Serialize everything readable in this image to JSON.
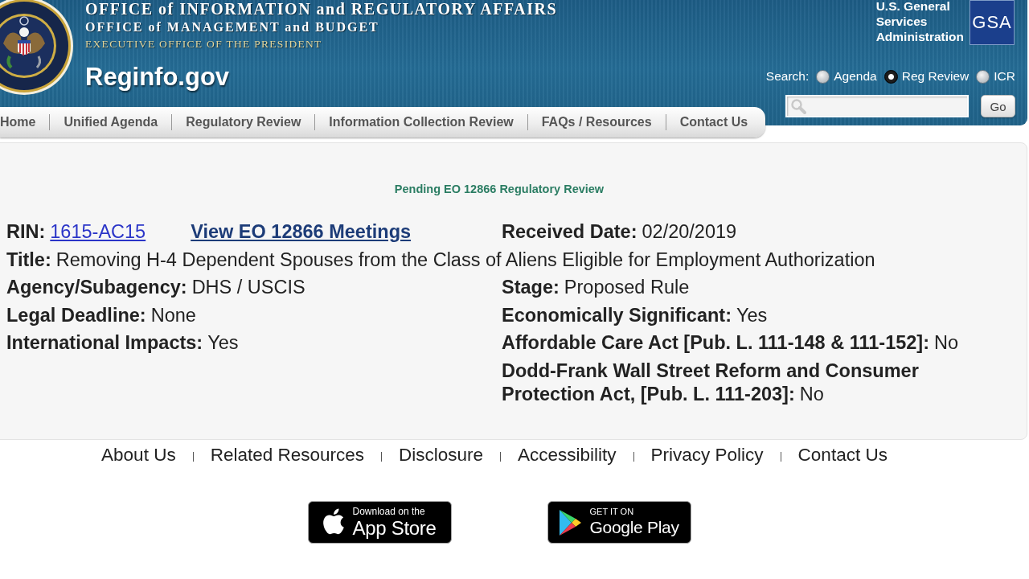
{
  "header": {
    "title_lines": [
      "OFFICE of INFORMATION and REGULATORY AFFAIRS",
      "OFFICE of MANAGEMENT and BUDGET",
      "EXECUTIVE OFFICE OF THE PRESIDENT"
    ],
    "site_name": "Reginfo.gov",
    "agency": {
      "name_lines": [
        "U.S. General",
        "Services",
        "Administration"
      ],
      "logo": "GSA"
    },
    "search": {
      "label": "Search:",
      "options": [
        {
          "label": "Agenda",
          "selected": false
        },
        {
          "label": "Reg Review",
          "selected": true
        },
        {
          "label": "ICR",
          "selected": false
        }
      ],
      "button": "Go"
    }
  },
  "nav": [
    "Home",
    "Unified Agenda",
    "Regulatory Review",
    "Information Collection Review",
    "FAQs / Resources",
    "Contact Us"
  ],
  "review": {
    "heading": "Pending EO 12866 Regulatory Review",
    "rows": [
      {
        "left": {
          "label": "RIN:",
          "link": "1615-AC15"
        },
        "link": "View EO 12866 Meetings",
        "right": {
          "label": "Received Date:",
          "value": "02/20/2019"
        }
      },
      {
        "full": {
          "label": "Title:",
          "value": "Removing H-4 Dependent Spouses from the Class of Aliens Eligible for Employment Authorization"
        }
      },
      {
        "left": {
          "label": "Agency/Subagency:",
          "value": "DHS / USCIS"
        },
        "right": {
          "label": "Stage:",
          "value": "Proposed Rule"
        }
      },
      {
        "left": {
          "label": "Legal Deadline:",
          "value": "None"
        },
        "right": {
          "label": "Economically Significant:",
          "value": "Yes"
        }
      },
      {
        "left": {
          "label": "International Impacts:",
          "value": "Yes"
        },
        "right": {
          "label": "Affordable Care Act [Pub. L. 111-148 & 111-152]:",
          "value": "No"
        }
      },
      {
        "right": {
          "label": "Dodd-Frank Wall Street Reform and Consumer Protection Act, [Pub. L. 111-203]:",
          "value": "No"
        }
      }
    ]
  },
  "footer": {
    "links": [
      "About Us",
      "Related Resources",
      "Disclosure",
      "Accessibility",
      "Privacy Policy",
      "Contact Us"
    ],
    "badges": [
      {
        "kind": "apple",
        "caption": "Download on the",
        "title": "App Store"
      },
      {
        "kind": "google",
        "caption": "GET IT ON",
        "title": "Google Play"
      }
    ]
  }
}
